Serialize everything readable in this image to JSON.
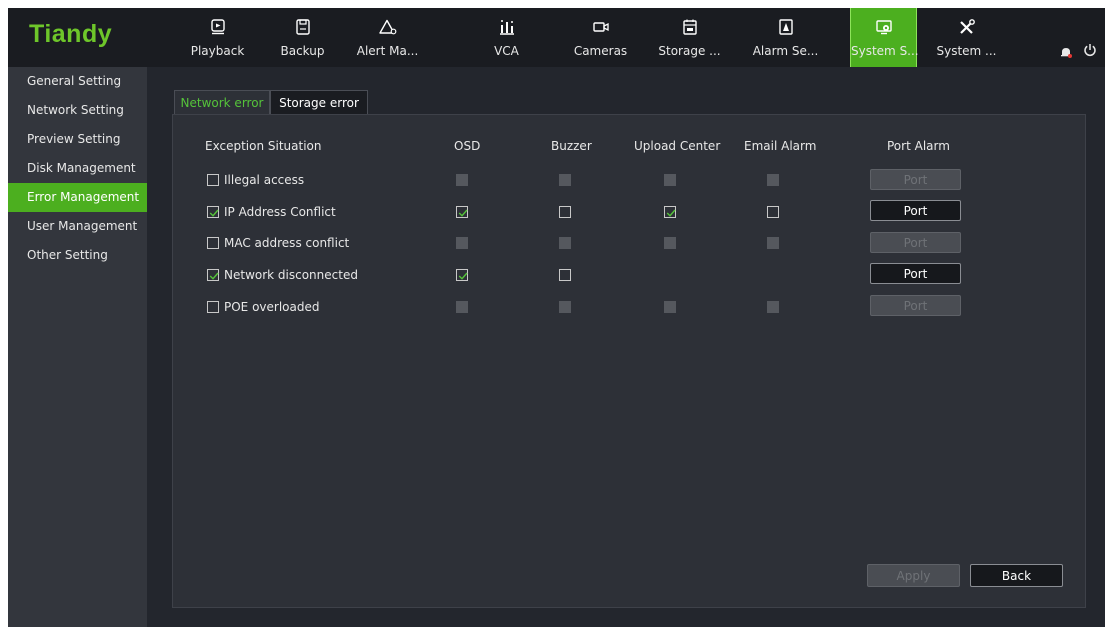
{
  "app": {
    "logo": "Tiandy"
  },
  "colors": {
    "accent": "#4caf1f",
    "logo": "#6ec62a",
    "active_tab_text": "#55c33a"
  },
  "nav": [
    {
      "label": "Playback",
      "icon": "playback-icon",
      "active": false
    },
    {
      "label": "Backup",
      "icon": "save-icon",
      "active": false
    },
    {
      "label": "Alert Ma...",
      "icon": "alert-icon",
      "active": false
    },
    {
      "label": "VCA",
      "icon": "vca-icon",
      "active": false
    },
    {
      "label": "Cameras",
      "icon": "camera-icon",
      "active": false
    },
    {
      "label": "Storage ...",
      "icon": "storage-icon",
      "active": false
    },
    {
      "label": "Alarm Se...",
      "icon": "alarm-icon",
      "active": false
    },
    {
      "label": "System S...",
      "icon": "system-settings-icon",
      "active": true
    },
    {
      "label": "System ...",
      "icon": "tools-icon",
      "active": false
    }
  ],
  "sidebar": {
    "items": [
      {
        "label": "General Setting"
      },
      {
        "label": "Network Setting"
      },
      {
        "label": "Preview Setting"
      },
      {
        "label": "Disk Management"
      },
      {
        "label": "Error Management",
        "active": true
      },
      {
        "label": "User Management"
      },
      {
        "label": "Other Setting"
      }
    ]
  },
  "tabs": [
    {
      "label": "Network error",
      "active": true
    },
    {
      "label": "Storage error",
      "active": false
    }
  ],
  "table": {
    "headers": [
      "Exception Situation",
      "OSD",
      "Buzzer",
      "Upload Center",
      "Email Alarm",
      "Port Alarm"
    ],
    "rows": [
      {
        "label": "Illegal access",
        "checked": false,
        "osd": "disabled",
        "buzzer": "disabled",
        "upload": "disabled",
        "email": "disabled",
        "port": "Port",
        "port_enabled": false
      },
      {
        "label": "IP Address Conflict",
        "checked": true,
        "osd": "checked",
        "buzzer": "unchecked",
        "upload": "checked",
        "email": "unchecked",
        "port": "Port",
        "port_enabled": true
      },
      {
        "label": "MAC address conflict",
        "checked": false,
        "osd": "disabled",
        "buzzer": "disabled",
        "upload": "disabled",
        "email": "disabled",
        "port": "Port",
        "port_enabled": false
      },
      {
        "label": "Network disconnected",
        "checked": true,
        "osd": "checked",
        "buzzer": "unchecked",
        "upload": null,
        "email": null,
        "port": "Port",
        "port_enabled": true
      },
      {
        "label": "POE overloaded",
        "checked": false,
        "osd": "disabled",
        "buzzer": "disabled",
        "upload": "disabled",
        "email": "disabled",
        "port": "Port",
        "port_enabled": false
      }
    ]
  },
  "buttons": {
    "apply": "Apply",
    "back": "Back"
  }
}
